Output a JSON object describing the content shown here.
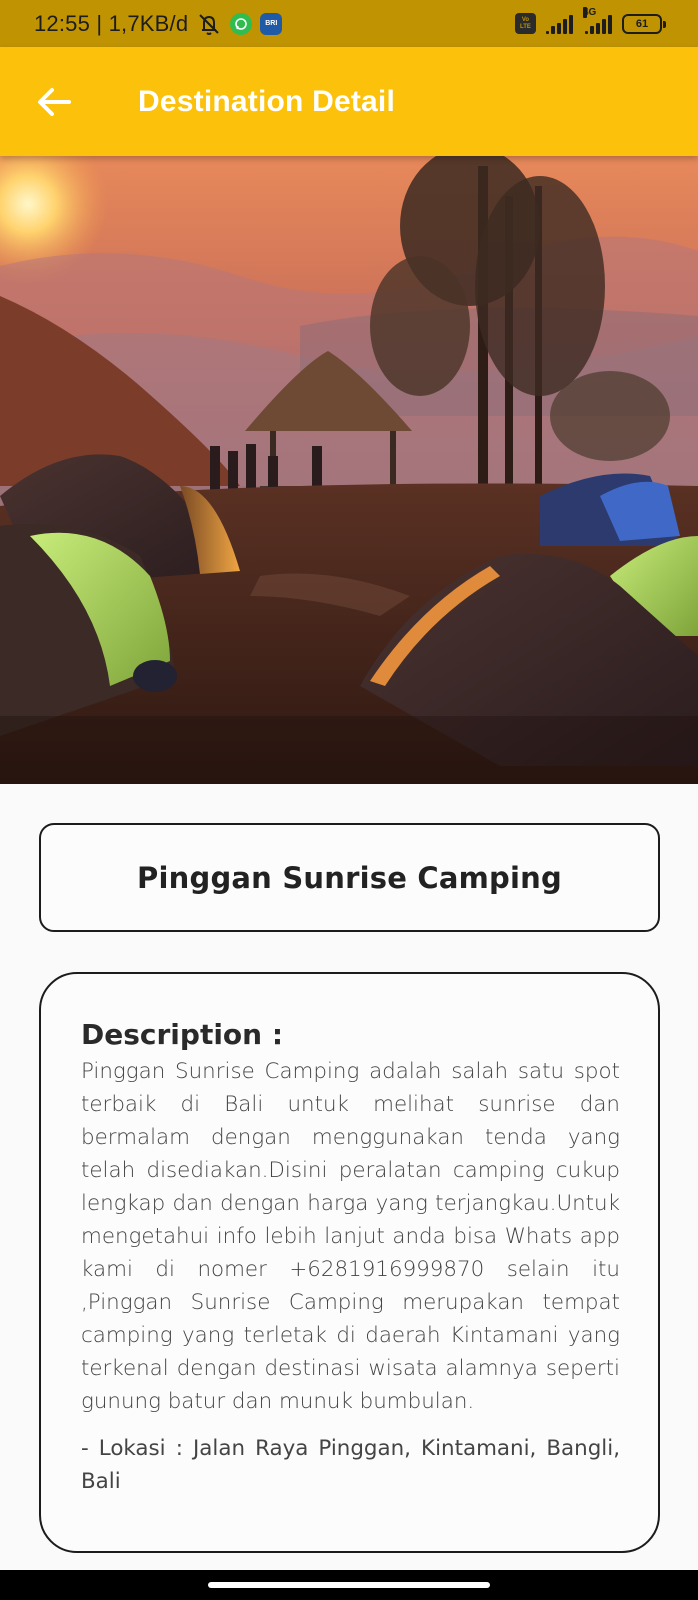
{
  "status_bar": {
    "time_speed": "12:55 | 1,7KB/d",
    "bri_label": "BRI",
    "volte_top": "Vo",
    "volte_bottom": "LTE",
    "net_label": "4G",
    "battery": "61"
  },
  "app_bar": {
    "title": "Destination Detail",
    "back_icon": "arrow-left-icon"
  },
  "hero": {
    "image": "camping-sunrise-photo"
  },
  "destination": {
    "name": "Pinggan Sunrise Camping",
    "description_heading": "Description :",
    "description": "Pinggan Sunrise Camping adalah salah satu spot terbaik di Bali untuk melihat sunrise dan bermalam dengan menggunakan tenda yang telah disediakan.Disini peralatan camping cukup lengkap dan dengan harga yang terjangkau.Untuk mengetahui info lebih lanjut anda bisa Whats app kami di nomer +6281916999870 selain itu ,Pinggan Sunrise Camping merupakan tempat camping yang terletak di daerah Kintamani yang terkenal dengan destinasi wisata alamnya seperti gunung batur dan munuk bumbulan.",
    "location": "- Lokasi : Jalan Raya Pinggan, Kintamani, Bangli, Bali"
  },
  "colors": {
    "status_bar": "#bf9302",
    "app_bar": "#fcc10a",
    "background": "#fafafa",
    "card_border": "#1c1c1c"
  }
}
